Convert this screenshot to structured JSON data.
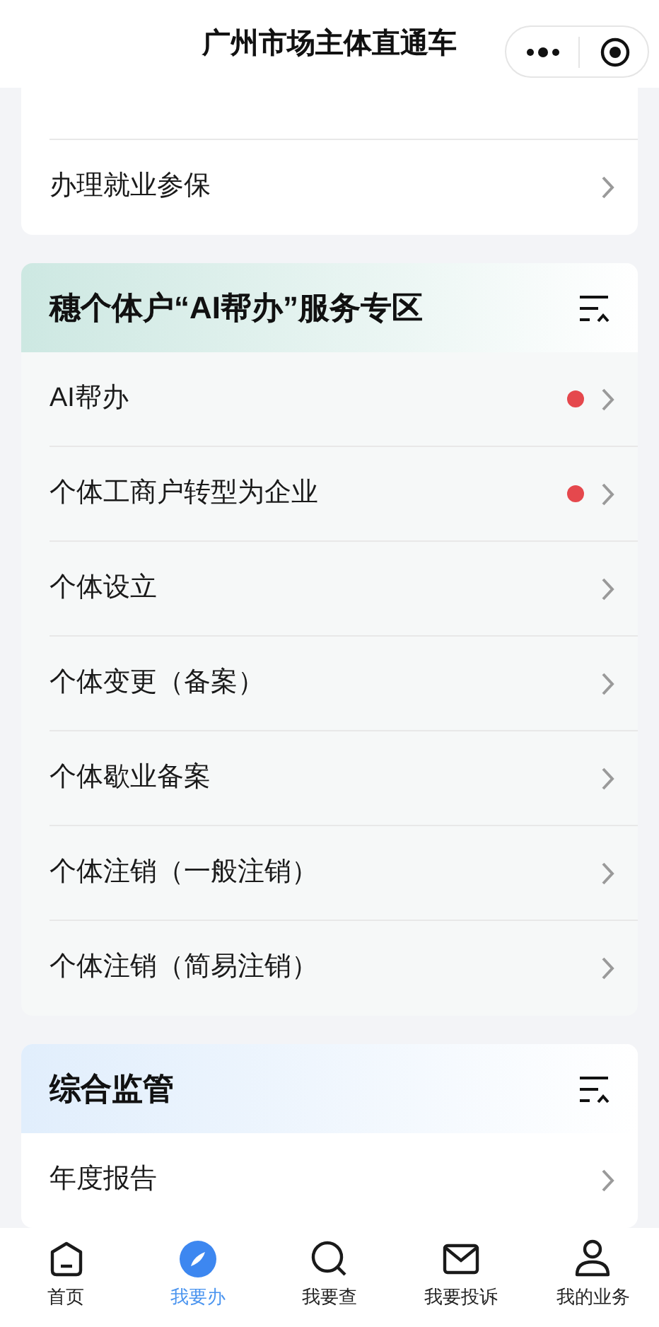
{
  "header": {
    "title": "广州市场主体直通车"
  },
  "sections": [
    {
      "items": [
        {
          "label": "办理就业参保",
          "dot": false
        }
      ]
    },
    {
      "title": "穗个体户“AI帮办”服务专区",
      "items": [
        {
          "label": "AI帮办",
          "dot": true
        },
        {
          "label": "个体工商户转型为企业",
          "dot": true
        },
        {
          "label": "个体设立",
          "dot": false
        },
        {
          "label": "个体变更（备案）",
          "dot": false
        },
        {
          "label": "个体歇业备案",
          "dot": false
        },
        {
          "label": "个体注销（一般注销）",
          "dot": false
        },
        {
          "label": "个体注销（简易注销）",
          "dot": false
        }
      ]
    },
    {
      "title": "综合监管",
      "items": [
        {
          "label": "年度报告",
          "dot": false
        }
      ]
    }
  ],
  "nav": [
    {
      "label": "首页",
      "selected": false
    },
    {
      "label": "我要办",
      "selected": true
    },
    {
      "label": "我要查",
      "selected": false
    },
    {
      "label": "我要投诉",
      "selected": false
    },
    {
      "label": "我的业务",
      "selected": false
    }
  ]
}
